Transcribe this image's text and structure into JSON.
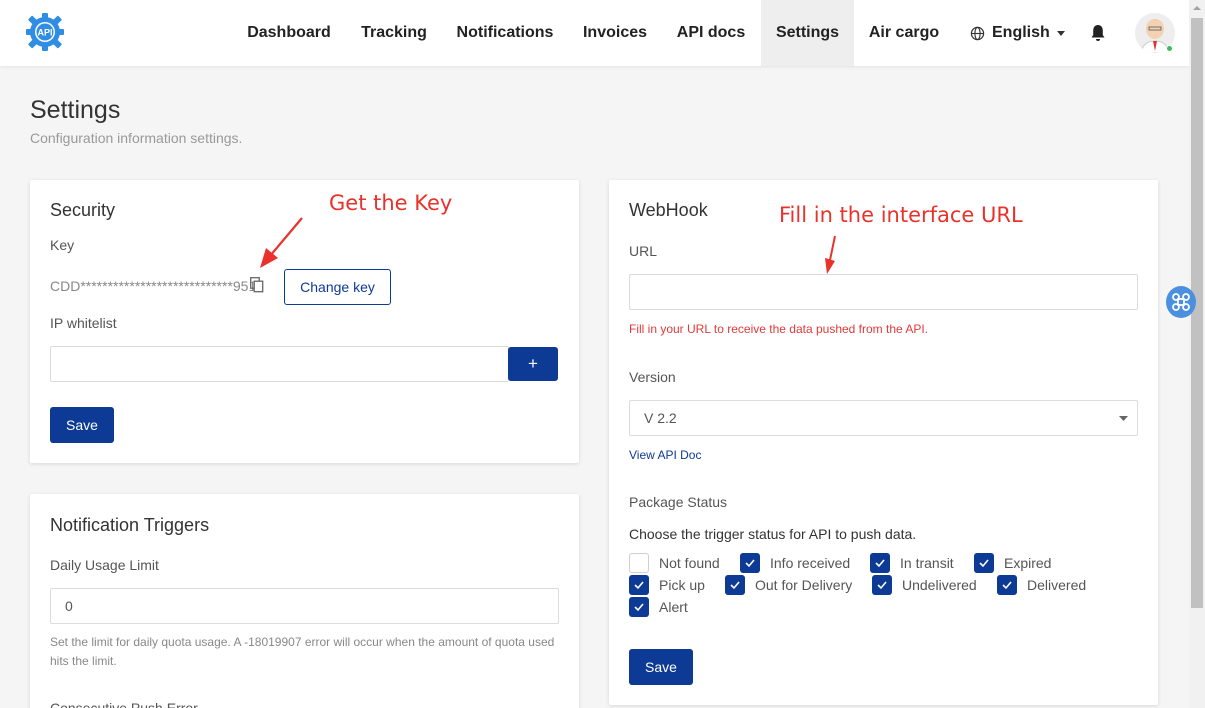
{
  "nav": {
    "logo_text": "API",
    "items": [
      {
        "label": "Dashboard",
        "active": false
      },
      {
        "label": "Tracking",
        "active": false
      },
      {
        "label": "Notifications",
        "active": false
      },
      {
        "label": "Invoices",
        "active": false
      },
      {
        "label": "API docs",
        "active": false
      },
      {
        "label": "Settings",
        "active": true
      },
      {
        "label": "Air cargo",
        "active": false
      }
    ],
    "language": "English"
  },
  "page": {
    "title": "Settings",
    "subtitle": "Configuration information settings."
  },
  "security": {
    "title": "Security",
    "key_label": "Key",
    "key_value": "CDD****************************951",
    "change_key_label": "Change key",
    "ip_whitelist_label": "IP whitelist",
    "ip_input_value": "",
    "add_label": "+",
    "save_label": "Save"
  },
  "notification_triggers": {
    "title": "Notification Triggers",
    "daily_limit_label": "Daily Usage Limit",
    "daily_limit_value": "0",
    "daily_limit_hint": "Set the limit for daily quota usage. A -18019907 error will occur when the amount of quota used hits the limit.",
    "consecutive_label": "Consecutive Push Error"
  },
  "webhook": {
    "title": "WebHook",
    "url_label": "URL",
    "url_value": "",
    "url_hint": "Fill in your URL to receive the data pushed from the API.",
    "version_label": "Version",
    "version_value": "V 2.2",
    "view_doc_label": "View API Doc",
    "package_status_label": "Package Status",
    "trigger_text": "Choose the trigger status for API to push data.",
    "statuses": [
      {
        "label": "Not found",
        "checked": false
      },
      {
        "label": "Info received",
        "checked": true
      },
      {
        "label": "In transit",
        "checked": true
      },
      {
        "label": "Expired",
        "checked": true
      },
      {
        "label": "Pick up",
        "checked": true
      },
      {
        "label": "Out for Delivery",
        "checked": true
      },
      {
        "label": "Undelivered",
        "checked": true
      },
      {
        "label": "Delivered",
        "checked": true
      },
      {
        "label": "Alert",
        "checked": true
      }
    ],
    "save_label": "Save"
  },
  "annotations": {
    "get_key": "Get the Key",
    "fill_url": "Fill in the interface URL"
  },
  "colors": {
    "primary": "#0d3a94",
    "annotation": "#e8322b",
    "hint_red": "#e03a3a"
  }
}
